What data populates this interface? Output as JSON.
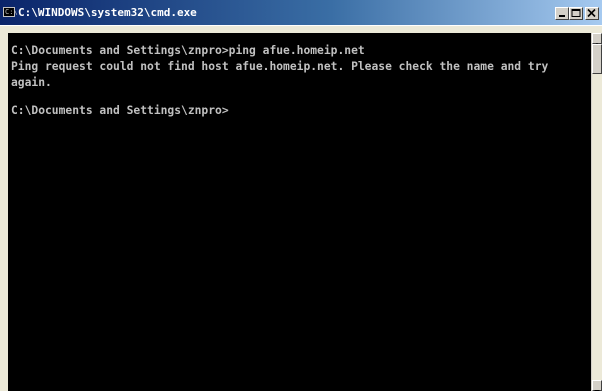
{
  "window": {
    "title": "C:\\WINDOWS\\system32\\cmd.exe",
    "icon": "console-icon",
    "icon_label": "C:\\"
  },
  "controls": {
    "minimize_icon": "minimize-icon",
    "maximize_icon": "maximize-icon",
    "close_icon": "close-icon"
  },
  "console": {
    "lines": [
      "",
      "C:\\Documents and Settings\\znpro>ping afue.homeip.net",
      "Ping request could not find host afue.homeip.net. Please check the name and try",
      "again.",
      "",
      "C:\\Documents and Settings\\znpro>"
    ],
    "text_color": "#c0c0c0",
    "background_color": "#000000"
  },
  "scrollbar": {
    "up_icon": "scroll-up-arrow-icon",
    "down_icon": "scroll-down-arrow-icon"
  }
}
